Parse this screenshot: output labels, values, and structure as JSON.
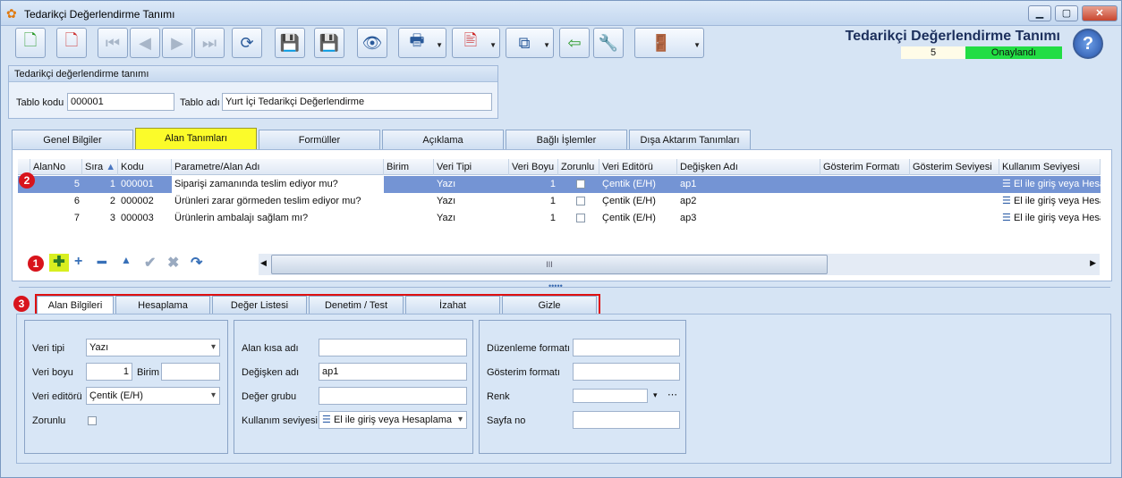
{
  "window": {
    "title": "Tedarikçi Değerlendirme Tanımı"
  },
  "header": {
    "title": "Tedarikçi Değerlendirme Tanımı",
    "number": "5",
    "status": "Onaylandı",
    "status_color": "#22dd44"
  },
  "group": {
    "title": "Tedarikçi değerlendirme tanımı",
    "code_label": "Tablo kodu",
    "code_value": "000001",
    "name_label": "Tablo adı",
    "name_value": "Yurt İçi Tedarikçi Değerlendirme"
  },
  "tabs": [
    "Genel Bilgiler",
    "Alan Tanımları",
    "Formüller",
    "Açıklama",
    "Bağlı İşlemler",
    "Dışa Aktarım Tanımları"
  ],
  "grid": {
    "columns": [
      "AlanNo",
      "Sıra",
      "Kodu",
      "Parametre/Alan Adı",
      "Birim",
      "Veri Tipi",
      "Veri Boyu",
      "Zorunlu",
      "Veri Editörü",
      "Değişken Adı",
      "Gösterim Formatı",
      "Gösterim Seviyesi",
      "Kullanım Seviyesi"
    ],
    "rows": [
      {
        "alanno": "5",
        "sira": "1",
        "kodu": "000001",
        "ad": "Siparişi zamanında teslim ediyor mu?",
        "tip": "Yazı",
        "boy": "1",
        "editor": "Çentik (E/H)",
        "degisken": "ap1",
        "kullanim": "El ile giriş veya Hesaplama"
      },
      {
        "alanno": "6",
        "sira": "2",
        "kodu": "000002",
        "ad": "Ürünleri zarar görmeden teslim ediyor mu?",
        "tip": "Yazı",
        "boy": "1",
        "editor": "Çentik (E/H)",
        "degisken": "ap2",
        "kullanim": "El ile giriş veya Hesaplama"
      },
      {
        "alanno": "7",
        "sira": "3",
        "kodu": "000003",
        "ad": "Ürünlerin ambalajı sağlam mı?",
        "tip": "Yazı",
        "boy": "1",
        "editor": "Çentik (E/H)",
        "degisken": "ap3",
        "kullanim": "El ile giriş veya Hesaplama"
      }
    ]
  },
  "badges": [
    "1",
    "2",
    "3"
  ],
  "scroll_marker": "III",
  "detail_tabs": [
    "Alan Bilgileri",
    "Hesaplama",
    "Değer Listesi",
    "Denetim / Test",
    "İzahat",
    "Gizle"
  ],
  "detail": {
    "veri_tipi_label": "Veri tipi",
    "veri_tipi": "Yazı",
    "veri_boyu_label": "Veri boyu",
    "veri_boyu": "1",
    "birim_label": "Birim",
    "veri_editoru_label": "Veri editörü",
    "veri_editoru": "Çentik (E/H)",
    "zorunlu_label": "Zorunlu",
    "alan_kisa_adi_label": "Alan kısa adı",
    "degisken_adi_label": "Değişken adı",
    "degisken_adi": "ap1",
    "deger_grubu_label": "Değer grubu",
    "kullanim_label": "Kullanım seviyesi",
    "kullanim": "El ile giriş veya Hesaplama",
    "duzenleme_label": "Düzenleme formatı",
    "gosterim_label": "Gösterim formatı",
    "renk_label": "Renk",
    "sayfa_label": "Sayfa no"
  }
}
